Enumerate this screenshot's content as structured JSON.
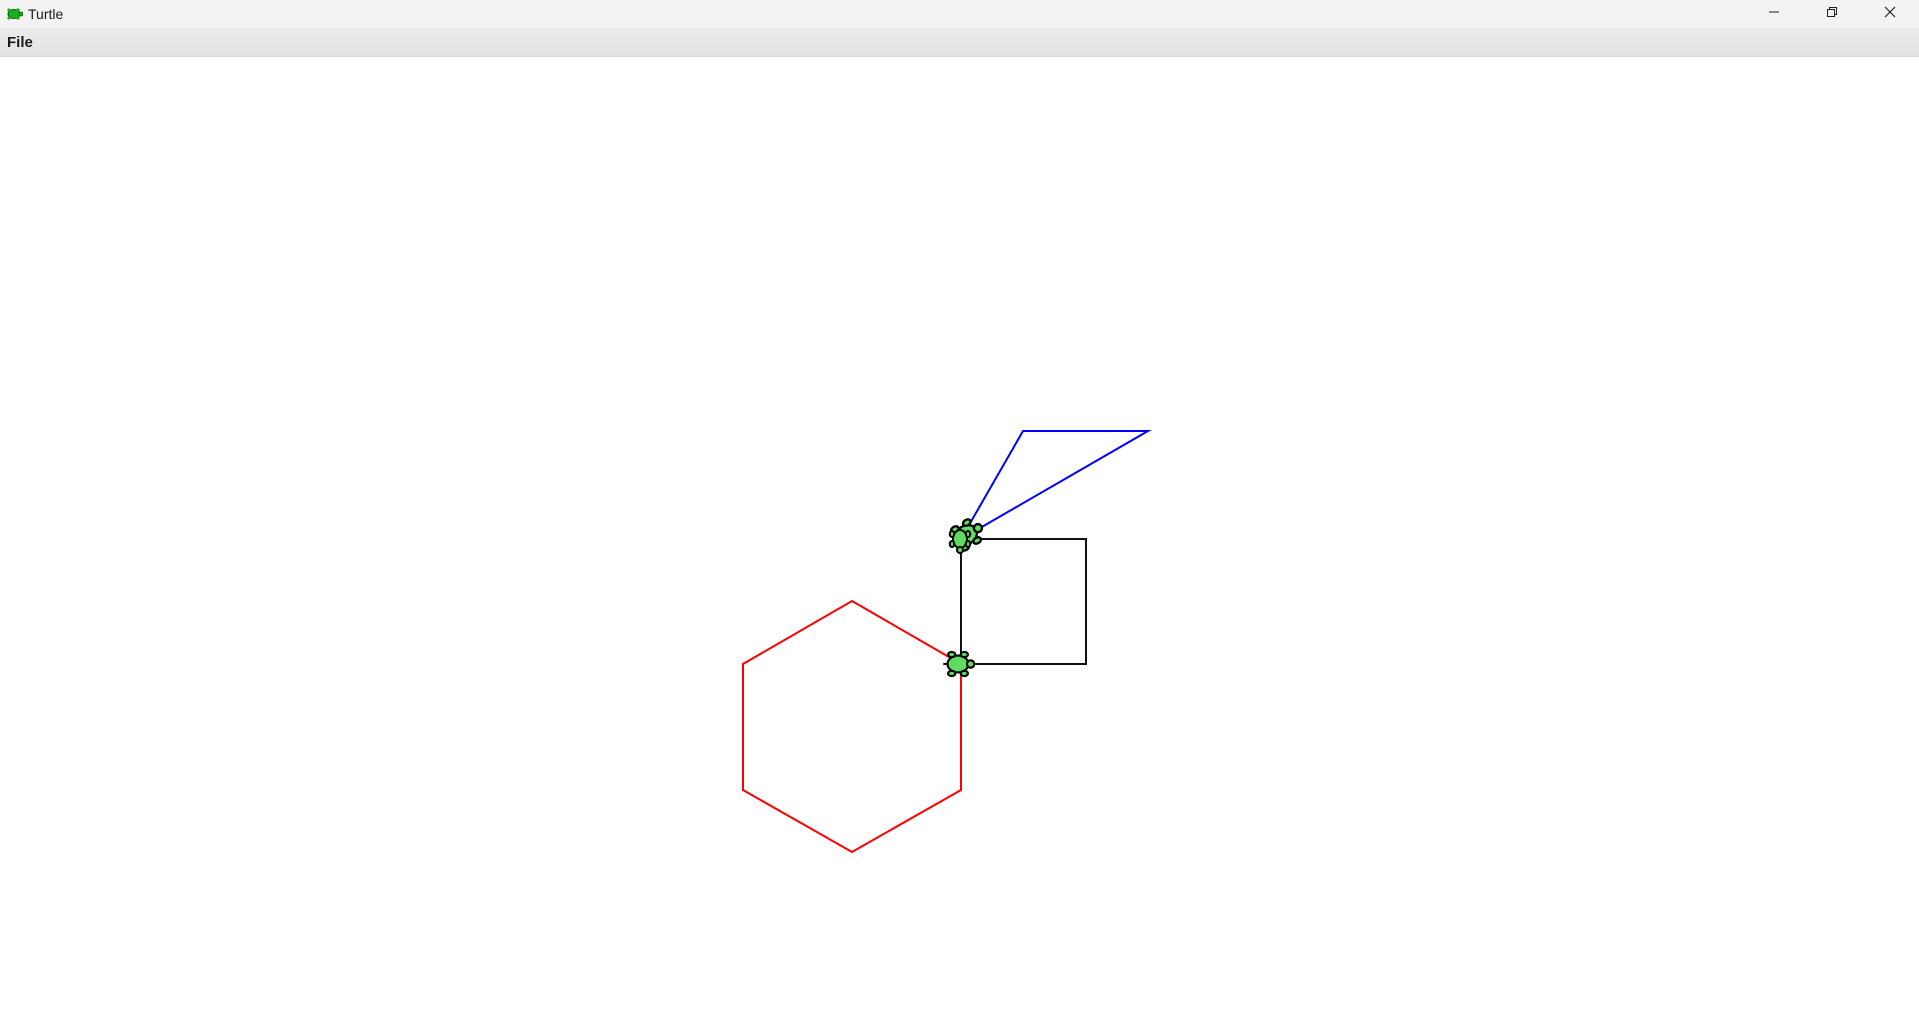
{
  "window": {
    "title": "Turtle",
    "app_icon": "turtle-icon",
    "controls": [
      "minimize-icon",
      "restore-icon",
      "close-icon"
    ]
  },
  "menubar": {
    "items": [
      {
        "label": "File"
      }
    ]
  },
  "canvas": {
    "background": "#ffffff",
    "shapes": [
      {
        "kind": "hexagon",
        "color": "#ff0000"
      },
      {
        "kind": "square",
        "color": "#000000"
      },
      {
        "kind": "triangle",
        "color": "#0000ff"
      }
    ],
    "turtles": [
      {
        "color": "#4cd04c"
      },
      {
        "color": "#4cd04c"
      }
    ]
  }
}
